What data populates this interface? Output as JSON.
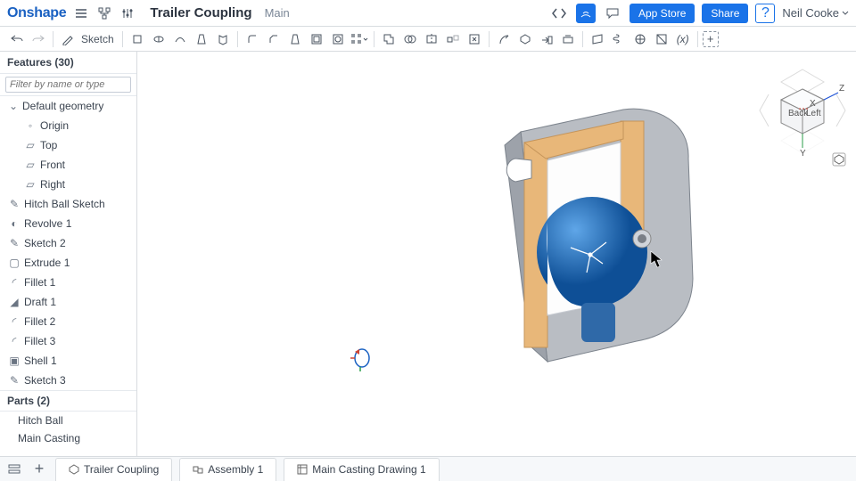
{
  "header": {
    "logo": "Onshape",
    "doc_title": "Trailer Coupling",
    "doc_sub": "Main",
    "app_store": "App Store",
    "share": "Share",
    "user": "Neil Cooke"
  },
  "toolbar": {
    "sketch_label": "Sketch"
  },
  "features": {
    "header": "Features (30)",
    "filter_placeholder": "Filter by name or type",
    "default_geometry": "Default geometry",
    "items": [
      {
        "label": "Origin"
      },
      {
        "label": "Top"
      },
      {
        "label": "Front"
      },
      {
        "label": "Right"
      }
    ],
    "list": [
      {
        "label": "Hitch Ball Sketch",
        "icon": "sketch"
      },
      {
        "label": "Revolve 1",
        "icon": "revolve"
      },
      {
        "label": "Sketch 2",
        "icon": "sketch"
      },
      {
        "label": "Extrude 1",
        "icon": "extrude"
      },
      {
        "label": "Fillet 1",
        "icon": "fillet"
      },
      {
        "label": "Draft 1",
        "icon": "draft"
      },
      {
        "label": "Fillet 2",
        "icon": "fillet"
      },
      {
        "label": "Fillet 3",
        "icon": "fillet"
      },
      {
        "label": "Shell 1",
        "icon": "shell"
      },
      {
        "label": "Sketch 3",
        "icon": "sketch"
      }
    ]
  },
  "parts": {
    "header": "Parts (2)",
    "items": [
      {
        "label": "Hitch Ball"
      },
      {
        "label": "Main Casting"
      }
    ]
  },
  "view_cube": {
    "back": "Back",
    "left": "Left",
    "axes": {
      "x": "X",
      "y": "Y",
      "z": "Z"
    }
  },
  "tabs": [
    {
      "label": "Trailer Coupling",
      "icon": "partstudio"
    },
    {
      "label": "Assembly 1",
      "icon": "assembly"
    },
    {
      "label": "Main Casting Drawing 1",
      "icon": "drawing"
    }
  ]
}
